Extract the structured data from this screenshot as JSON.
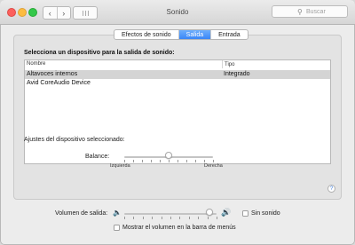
{
  "window": {
    "title": "Sonido",
    "back_icon": "chevron-left-icon",
    "forward_icon": "chevron-right-icon",
    "grid_icon": "grid-icon"
  },
  "search": {
    "placeholder": "Buscar",
    "icon": "search-icon"
  },
  "tabs": [
    {
      "label": "Efectos de sonido",
      "active": false
    },
    {
      "label": "Salida",
      "active": true
    },
    {
      "label": "Entrada",
      "active": false
    }
  ],
  "output": {
    "heading": "Selecciona un dispositivo para la salida de sonido:",
    "columns": [
      "Nombre",
      "Tipo"
    ],
    "devices": [
      {
        "name": "Altavoces internos",
        "type": "Integrado",
        "selected": true
      },
      {
        "name": "Avid CoreAudio Device",
        "type": "",
        "selected": false
      }
    ]
  },
  "settings": {
    "heading": "Ajustes del dispositivo seleccionado:",
    "balance_label": "Balance:",
    "left_label": "Izquierda",
    "right_label": "Derecha",
    "balance_value": 0.5
  },
  "volume": {
    "label": "Volumen de salida:",
    "value": 0.92,
    "mute_label": "Sin sonido",
    "mute_checked": false,
    "menu_bar_label": "Mostrar el volumen en la barra de menús",
    "menu_bar_checked": false
  },
  "colors": {
    "accent": "#3a86f7",
    "selected_row": "#d4d4d4"
  }
}
